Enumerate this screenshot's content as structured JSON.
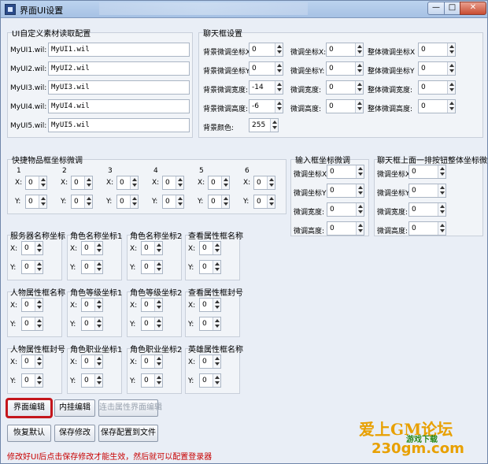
{
  "window": {
    "title": "界面UI设置",
    "min": "—",
    "max": "□",
    "close": "✕"
  },
  "ui_group": {
    "legend": "UI自定义素材读取配置",
    "rows": [
      {
        "label": "MyUI1.wil:",
        "value": "MyUI1.wil"
      },
      {
        "label": "MyUI2.wil:",
        "value": "MyUI2.wil"
      },
      {
        "label": "MyUI3.wil:",
        "value": "MyUI3.wil"
      },
      {
        "label": "MyUI4.wil:",
        "value": "MyUI4.wil"
      },
      {
        "label": "MyUI5.wil:",
        "value": "MyUI5.wil"
      }
    ]
  },
  "chat_group": {
    "legend": "聊天框设置",
    "col1": [
      {
        "label": "背景微调坐标X",
        "value": "0"
      },
      {
        "label": "背景微调坐标Y",
        "value": "0"
      },
      {
        "label": "背景微调宽度:",
        "value": "-14"
      },
      {
        "label": "背景微调高度:",
        "value": "-6"
      },
      {
        "label": "背景颜色:",
        "value": "255"
      }
    ],
    "col2": [
      {
        "label": "微调坐标X:",
        "value": "0"
      },
      {
        "label": "微调坐标Y:",
        "value": "0"
      },
      {
        "label": "微调宽度:",
        "value": "0"
      },
      {
        "label": "微调高度:",
        "value": "0"
      }
    ],
    "col3": [
      {
        "label": "整体微调坐标X",
        "value": "0"
      },
      {
        "label": "整体微调坐标Y",
        "value": "0"
      },
      {
        "label": "整体微调宽度:",
        "value": "0"
      },
      {
        "label": "整体微调高度:",
        "value": "0"
      }
    ]
  },
  "quick_group": {
    "legend": "快捷物品框坐标微调",
    "slots": [
      {
        "num": "1",
        "x": "0",
        "y": "0"
      },
      {
        "num": "2",
        "x": "0",
        "y": "0"
      },
      {
        "num": "3",
        "x": "0",
        "y": "0"
      },
      {
        "num": "4",
        "x": "0",
        "y": "0"
      },
      {
        "num": "5",
        "x": "0",
        "y": "0"
      },
      {
        "num": "6",
        "x": "0",
        "y": "0"
      }
    ],
    "x_label": "X:",
    "y_label": "Y:"
  },
  "input_group": {
    "legend": "输入框坐标微调",
    "rows": [
      {
        "label": "微调坐标X",
        "value": "0"
      },
      {
        "label": "微调坐标Y",
        "value": "0"
      },
      {
        "label": "微调宽度:",
        "value": "0"
      },
      {
        "label": "微调高度:",
        "value": "0"
      }
    ]
  },
  "chatbtn_group": {
    "legend": "聊天框上面一排按钮整体坐标微调",
    "rows": [
      {
        "label": "微调坐标X",
        "value": "0"
      },
      {
        "label": "微调坐标Y",
        "value": "0"
      },
      {
        "label": "微调宽度:",
        "value": "0"
      },
      {
        "label": "微调高度:",
        "value": "0"
      }
    ]
  },
  "coord_groups": [
    {
      "legend": "服务器名称坐标",
      "x": "0",
      "y": "0"
    },
    {
      "legend": "角色名称坐标1",
      "x": "0",
      "y": "0"
    },
    {
      "legend": "角色名称坐标2",
      "x": "0",
      "y": "0"
    },
    {
      "legend": "查看属性框名称",
      "x": "0",
      "y": "0"
    },
    {
      "legend": "人物属性框名称",
      "x": "0",
      "y": "0"
    },
    {
      "legend": "角色等级坐标1",
      "x": "0",
      "y": "0"
    },
    {
      "legend": "角色等级坐标2",
      "x": "0",
      "y": "0"
    },
    {
      "legend": "查看属性框封号",
      "x": "0",
      "y": "0"
    },
    {
      "legend": "人物属性框封号",
      "x": "0",
      "y": "0"
    },
    {
      "legend": "角色职业坐标1",
      "x": "0",
      "y": "0"
    },
    {
      "legend": "角色职业坐标2",
      "x": "0",
      "y": "0"
    },
    {
      "legend": "英雄属性框名称",
      "x": "0",
      "y": "0"
    }
  ],
  "buttons": {
    "ui_edit": "界面编辑",
    "hook_edit": "内挂编辑",
    "link_edit": "连击属性界面编辑",
    "restore": "恢复默认",
    "save": "保存修改",
    "save_file": "保存配置到文件"
  },
  "status": "修改好UI后点击保存修改才能生效，然后就可以配置登录器",
  "watermark": {
    "line1": "爱上GM论坛",
    "line2": "游戏下载",
    "line3": "230gm.com"
  },
  "colors": {
    "highlight": "#c4161c",
    "status": "#c80000"
  }
}
